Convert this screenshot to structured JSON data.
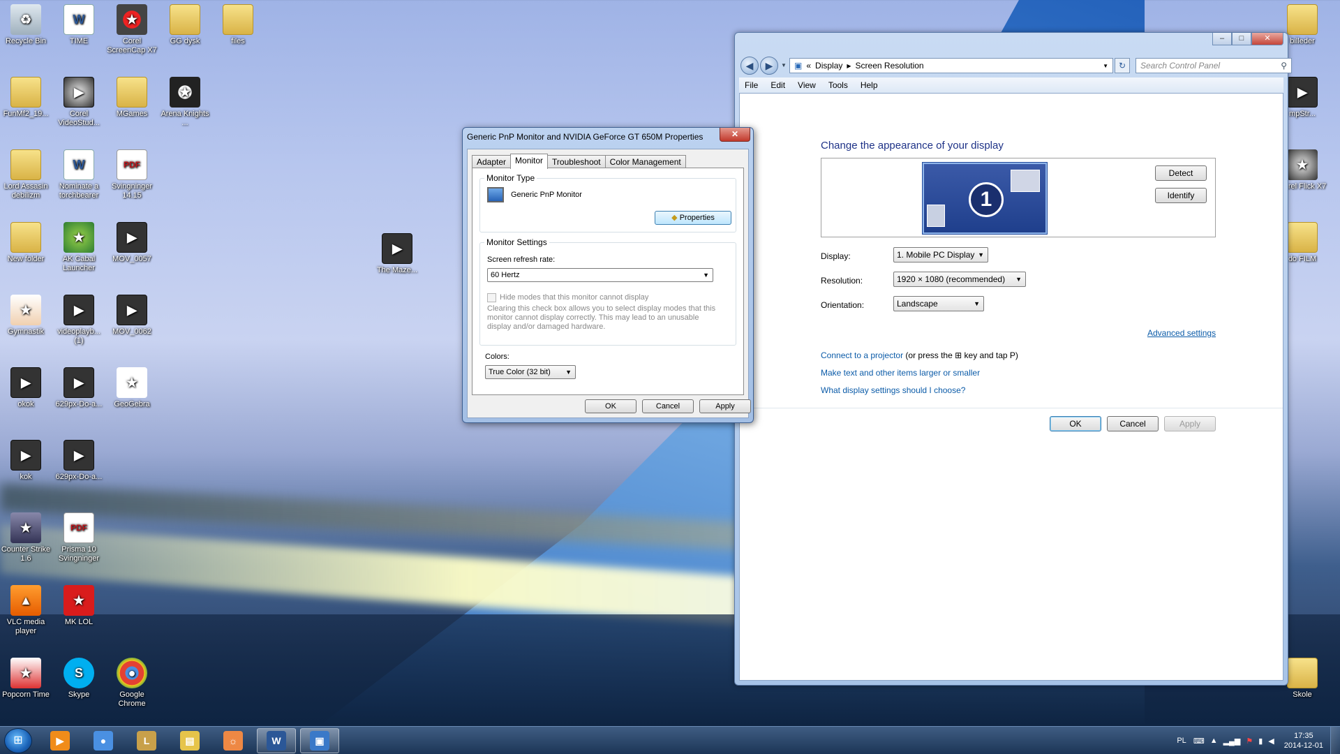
{
  "desktop": {
    "left_icons": [
      {
        "label": "Recycle Bin",
        "icon": "recycle-bin-icon"
      },
      {
        "label": "TIME",
        "icon": "word-document-icon"
      },
      {
        "label": "Corel ScreenCap X7",
        "icon": "screencap-icon"
      },
      {
        "label": "GG dysk",
        "icon": "folder-icon"
      },
      {
        "label": "files",
        "icon": "folder-icon"
      },
      {
        "label": "FunMf2_19...",
        "icon": "folder-icon"
      },
      {
        "label": "Corel VideoStud...",
        "icon": "videostudio-icon"
      },
      {
        "label": "MGames",
        "icon": "folder-icon"
      },
      {
        "label": "Arena Knights ...",
        "icon": "arena-knights-icon"
      },
      {
        "label": "Lord Assasin debilizm",
        "icon": "folder-icon"
      },
      {
        "label": "Nominate a torchbearer",
        "icon": "word-document-icon"
      },
      {
        "label": "Svingninger 14.15",
        "icon": "pdf-icon"
      },
      {
        "label": "New folder",
        "icon": "folder-icon"
      },
      {
        "label": "AK Cabal Launcher",
        "icon": "cabal-icon"
      },
      {
        "label": "MOV_0057",
        "icon": "video-file-icon"
      },
      {
        "label": "Gymnastik",
        "icon": "powerpoint-icon"
      },
      {
        "label": "videoplayb... (1)",
        "icon": "video-file-icon"
      },
      {
        "label": "MOV_0062",
        "icon": "video-file-icon"
      },
      {
        "label": "okok",
        "icon": "image-file-icon"
      },
      {
        "label": "629px-Do-a...",
        "icon": "image-file-icon"
      },
      {
        "label": "GeoGebra",
        "icon": "geogebra-icon"
      },
      {
        "label": "kok",
        "icon": "camera-file-icon"
      },
      {
        "label": "629px-Do-a...",
        "icon": "image-file-icon"
      },
      {
        "label": "Counter Strike 1.6",
        "icon": "counter-strike-icon"
      },
      {
        "label": "Prisma 10 Svingninger",
        "icon": "pdf-icon"
      },
      {
        "label": "VLC media player",
        "icon": "vlc-icon"
      },
      {
        "label": "MK LOL",
        "icon": "mk-lol-icon"
      },
      {
        "label": "Popcorn Time",
        "icon": "popcorn-icon"
      },
      {
        "label": "Skype",
        "icon": "skype-icon"
      },
      {
        "label": "Google Chrome",
        "icon": "chrome-icon"
      },
      {
        "label": "The Maze...",
        "icon": "video-file-icon"
      }
    ],
    "right_icons": [
      {
        "label": "billeder",
        "icon": "folder-icon"
      },
      {
        "label": "mpStr...",
        "icon": "video-file-icon"
      },
      {
        "label": "Corel Flick X7",
        "icon": "flick-icon"
      },
      {
        "label": "do FILM",
        "icon": "folder-icon"
      },
      {
        "label": "Skole",
        "icon": "folder-icon"
      }
    ]
  },
  "control_panel": {
    "breadcrumb": [
      "Display",
      "Screen Resolution"
    ],
    "breadcrumb_prefix": "«",
    "search_placeholder": "Search Control Panel",
    "menu": [
      "File",
      "Edit",
      "View",
      "Tools",
      "Help"
    ],
    "heading": "Change the appearance of your display",
    "monitor_number": "1",
    "detect": "Detect",
    "identify": "Identify",
    "display_label": "Display:",
    "display_value": "1. Mobile PC Display",
    "resolution_label": "Resolution:",
    "resolution_value": "1920 × 1080 (recommended)",
    "orientation_label": "Orientation:",
    "orientation_value": "Landscape",
    "advanced_settings": "Advanced settings",
    "projector_link": "Connect to a projector",
    "projector_text_1": "(or press the",
    "projector_text_2": "key and tap P)",
    "text_size_link": "Make text and other items larger or smaller",
    "what_settings_link": "What display settings should I choose?",
    "ok": "OK",
    "cancel": "Cancel",
    "apply": "Apply"
  },
  "dialog": {
    "title": "Generic PnP Monitor and NVIDIA GeForce GT 650M  Properties",
    "tabs": [
      "Adapter",
      "Monitor",
      "Troubleshoot",
      "Color Management"
    ],
    "active_tab": "Monitor",
    "monitor_type_label": "Monitor Type",
    "monitor_name": "Generic PnP Monitor",
    "properties_btn": "Properties",
    "monitor_settings_label": "Monitor Settings",
    "refresh_rate_label": "Screen refresh rate:",
    "refresh_rate_value": "60 Hertz",
    "hide_modes_label": "Hide modes that this monitor cannot display",
    "hide_modes_desc": "Clearing this check box allows you to select display modes that this monitor cannot display correctly. This may lead to an unusable display and/or damaged hardware.",
    "colors_label": "Colors:",
    "colors_value": "True Color (32 bit)",
    "ok": "OK",
    "cancel": "Cancel",
    "apply": "Apply"
  },
  "taskbar": {
    "buttons": [
      {
        "name": "media-player",
        "icon": "media-player-icon"
      },
      {
        "name": "chrome",
        "icon": "chrome-icon"
      },
      {
        "name": "league",
        "icon": "league-icon"
      },
      {
        "name": "explorer",
        "icon": "folder-icon"
      },
      {
        "name": "sun-app",
        "icon": "sun-icon"
      },
      {
        "name": "word",
        "icon": "word-icon"
      },
      {
        "name": "control-panel",
        "icon": "control-panel-icon"
      }
    ],
    "language": "PL",
    "time": "17:35",
    "date": "2014-12-01"
  }
}
